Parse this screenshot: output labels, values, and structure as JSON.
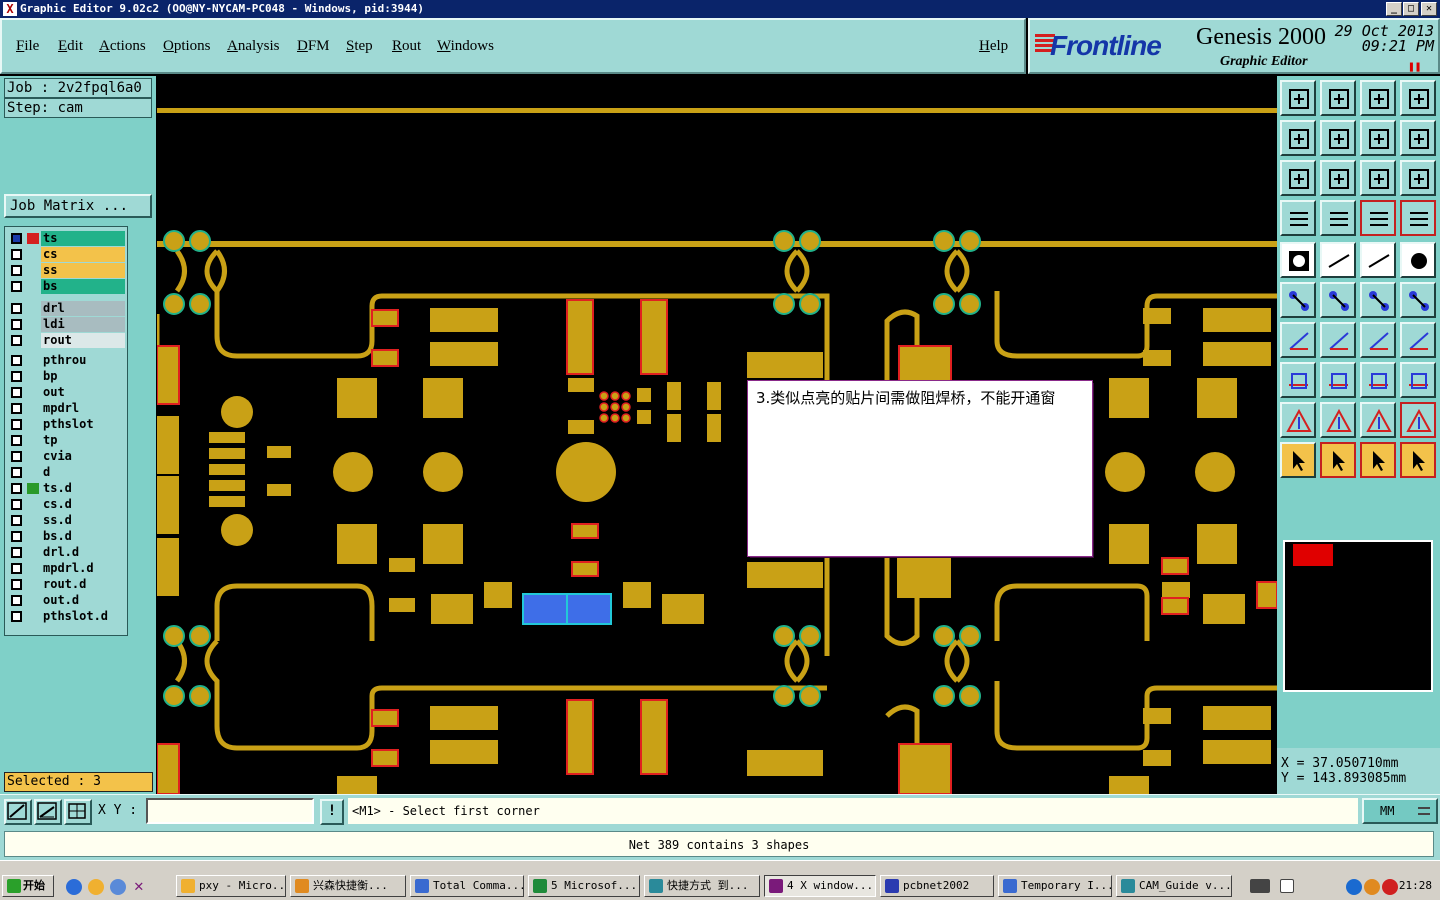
{
  "window": {
    "title": "Graphic Editor 9.02c2 (OO@NY-NYCAM-PC048 - Windows, pid:3944)"
  },
  "menu": {
    "items": [
      "File",
      "Edit",
      "Actions",
      "Options",
      "Analysis",
      "DFM",
      "Step",
      "Rout",
      "Windows"
    ],
    "help": "Help"
  },
  "brand": {
    "logo": "Frontline",
    "product": "Genesis 2000",
    "subtitle": "Graphic Editor",
    "date": "29 Oct 2013",
    "time": "09:21 PM"
  },
  "job": {
    "job_line": "Job : 2v2fpql6a0",
    "step_line": "Step: cam",
    "matrix_button": "Job Matrix ..."
  },
  "layers": [
    {
      "name": "ts",
      "color": "#22b28a"
    },
    {
      "name": "cs",
      "color": "#f3c24a"
    },
    {
      "name": "ss",
      "color": "#f3c24a"
    },
    {
      "name": "bs",
      "color": "#22b28a"
    },
    {
      "name": "drl",
      "color": "#a8bcc0"
    },
    {
      "name": "ldi",
      "color": "#a8bcc0"
    },
    {
      "name": "rout",
      "color": "#dce8e8"
    },
    {
      "name": "pthrou",
      "color": "#9fd9d5"
    },
    {
      "name": "bp",
      "color": "#9fd9d5"
    },
    {
      "name": "out",
      "color": "#9fd9d5"
    },
    {
      "name": "mpdrl",
      "color": "#9fd9d5"
    },
    {
      "name": "pthslot",
      "color": "#9fd9d5"
    },
    {
      "name": "tp",
      "color": "#9fd9d5"
    },
    {
      "name": "cvia",
      "color": "#9fd9d5"
    },
    {
      "name": "d",
      "color": "#9fd9d5"
    },
    {
      "name": "ts.d",
      "color": "#9fd9d5"
    },
    {
      "name": "cs.d",
      "color": "#9fd9d5"
    },
    {
      "name": "ss.d",
      "color": "#9fd9d5"
    },
    {
      "name": "bs.d",
      "color": "#9fd9d5"
    },
    {
      "name": "drl.d",
      "color": "#9fd9d5"
    },
    {
      "name": "mpdrl.d",
      "color": "#9fd9d5"
    },
    {
      "name": "rout.d",
      "color": "#9fd9d5"
    },
    {
      "name": "out.d",
      "color": "#9fd9d5"
    },
    {
      "name": "pthslot.d",
      "color": "#9fd9d5"
    }
  ],
  "selected": "Selected : 3",
  "popup": {
    "text": "3.类似点亮的贴片间需做阻焊桥，不能开通窗"
  },
  "coords": {
    "x": "X  = 37.050710mm",
    "y": "Y  = 143.893085mm"
  },
  "command": {
    "xy_label": "X Y :",
    "xy_value": "",
    "prompt": "<M1> - Select first corner",
    "units": "MM"
  },
  "status": "Net 389 contains 3 shapes",
  "taskbar": {
    "start": "开始",
    "tasks": [
      "pxy - Micro...",
      "兴森快捷衡...",
      "Total Comma...",
      "5 Microsof...",
      "快捷方式 到...",
      "4 X window...",
      "pcbnet2002",
      "Temporary I...",
      "CAM_Guide v..."
    ],
    "clock": "21:28"
  },
  "colors": {
    "copper": "#c9a116",
    "panel": "#9fd9d5",
    "highlight": "#3e6ee8",
    "mask_edge": "#e02020"
  }
}
